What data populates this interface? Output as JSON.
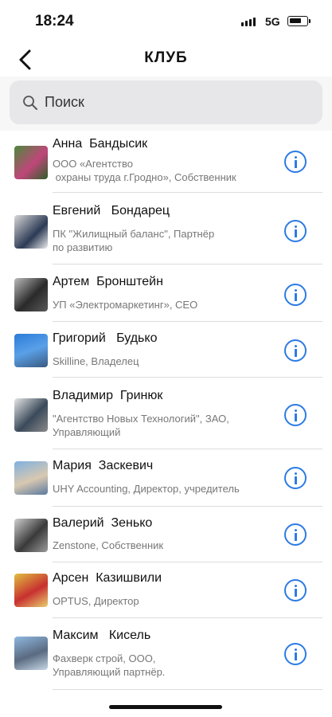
{
  "status": {
    "time": "18:24",
    "network": "5G",
    "battery_level": 0.75
  },
  "header": {
    "title": "КЛУБ",
    "back_icon": "chevron-left-icon"
  },
  "search": {
    "placeholder": "Поиск",
    "icon": "search-icon"
  },
  "colors": {
    "accent": "#2c7be5",
    "divider": "#dcdcdc",
    "subtitle": "#777777"
  },
  "members": [
    {
      "name": "Анна  Бандысик",
      "subtitle": "ООО «Агентство\n охраны труда г.Гродно», Собственник",
      "icon": "info-icon"
    },
    {
      "name": "Евгений   Бондарец",
      "subtitle": "ПК \"Жилищный баланс\", Партнёр\nпо развитию",
      "icon": "info-icon"
    },
    {
      "name": "Артем  Бронштейн",
      "subtitle": "УП «Электромаркетинг», CEO",
      "icon": "info-icon"
    },
    {
      "name": "Григорий   Будько",
      "subtitle": "Skilline, Владелец",
      "icon": "info-icon"
    },
    {
      "name": "Владимир  Гринюк",
      "subtitle": "\"Агентство Новых Технологий\", ЗАО,\nУправляющий",
      "icon": "info-icon"
    },
    {
      "name": "Мария  Заскевич",
      "subtitle": "UHY Accounting, Директор, учредитель",
      "icon": "info-icon"
    },
    {
      "name": "Валерий  Зенько",
      "subtitle": "Zenstone, Собственник",
      "icon": "info-icon"
    },
    {
      "name": "Арсен  Казишвили",
      "subtitle": "OPTUS, Директор",
      "icon": "info-icon"
    },
    {
      "name": "Максим   Кисель",
      "subtitle": "Фахверк строй, ООО,\nУправляющий партнёр.",
      "icon": "info-icon"
    }
  ]
}
